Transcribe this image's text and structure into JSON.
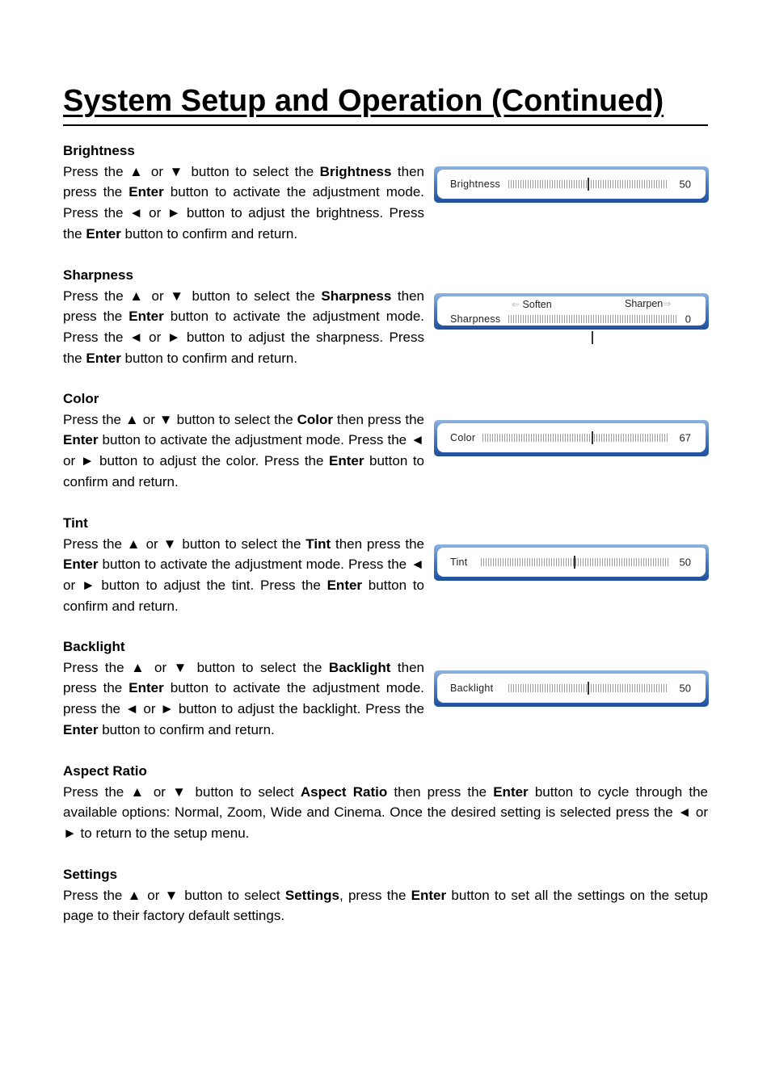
{
  "page": {
    "title": "System Setup and Operation (Continued)"
  },
  "sections": [
    {
      "heading": "Brightness",
      "body": [
        {
          "t": "Press the ▲ or ▼ button to select the "
        },
        {
          "b": "Brightness"
        },
        {
          "t": " then press the "
        },
        {
          "b": "Enter"
        },
        {
          "t": " button to activate the adjustment mode. Press the ◄ or ► button to adjust the brightness. Press the "
        },
        {
          "b": "Enter"
        },
        {
          "t": " button to confirm and return."
        }
      ]
    },
    {
      "heading": "Sharpness",
      "body": [
        {
          "t": "Press the ▲ or ▼ button to select the "
        },
        {
          "b": "Sharpness"
        },
        {
          "t": " then press the "
        },
        {
          "b": "Enter"
        },
        {
          "t": " button to activate the adjustment mode. Press the ◄ or ► button to adjust the sharpness. Press the "
        },
        {
          "b": "Enter"
        },
        {
          "t": " button to confirm and return."
        }
      ]
    },
    {
      "heading": "Color",
      "body": [
        {
          "t": "Press the ▲ or ▼ button to select the "
        },
        {
          "b": "Color"
        },
        {
          "t": " then press the "
        },
        {
          "b": "Enter"
        },
        {
          "t": " button to activate the adjustment mode. Press the ◄ or ► button to adjust the color. Press the "
        },
        {
          "b": "Enter"
        },
        {
          "t": " button to confirm and return."
        }
      ]
    },
    {
      "heading": "Tint",
      "body": [
        {
          "t": "Press the ▲ or ▼ button to select the "
        },
        {
          "b": "Tint"
        },
        {
          "t": " then press the "
        },
        {
          "b": "Enter"
        },
        {
          "t": " button to activate the adjustment mode. Press the ◄ or ► button to adjust the tint. Press the "
        },
        {
          "b": "Enter"
        },
        {
          "t": " button to confirm and return."
        }
      ]
    },
    {
      "heading": "Backlight",
      "body": [
        {
          "t": "Press the ▲ or ▼ button to select the "
        },
        {
          "b": "Backlight"
        },
        {
          "t": " then press the "
        },
        {
          "b": "Enter"
        },
        {
          "t": " button to activate the adjustment mode. press the ◄ or ► button to adjust the backlight. Press the "
        },
        {
          "b": "Enter"
        },
        {
          "t": " button to confirm and return."
        }
      ]
    },
    {
      "heading": "Aspect Ratio",
      "body": [
        {
          "t": "Press the ▲ or ▼ button to select "
        },
        {
          "b": "Aspect Ratio"
        },
        {
          "t": " then press the "
        },
        {
          "b": "Enter"
        },
        {
          "t": " button to cycle through the available options: Normal, Zoom, Wide and Cinema. Once the desired setting is selected press the ◄ or ► to return to the setup menu."
        }
      ]
    },
    {
      "heading": "Settings",
      "body": [
        {
          "t": "Press the ▲ or ▼ button to select "
        },
        {
          "b": "Settings"
        },
        {
          "t": ", press the "
        },
        {
          "b": "Enter"
        },
        {
          "t": " button to set all the settings on the setup page to their factory default settings."
        }
      ]
    }
  ],
  "panels": [
    {
      "label": "Brightness",
      "value": "50",
      "position_pct": 50
    },
    {
      "label": "Sharpness",
      "value": "0",
      "position_pct": 50,
      "left_hint": "Soften",
      "right_hint": "Sharpen",
      "left_arrow": "⇐",
      "right_arrow": "⇒"
    },
    {
      "label": "Color",
      "value": "67",
      "position_pct": 59
    },
    {
      "label": "Tint",
      "value": "50",
      "position_pct": 50
    },
    {
      "label": "Backlight",
      "value": "50",
      "position_pct": 50
    }
  ],
  "colors": {
    "panel_frame_top": "#8fb3e0",
    "panel_frame_bottom": "#1f4f9c",
    "panel_inner": "#ffffff",
    "text": "#000000"
  }
}
